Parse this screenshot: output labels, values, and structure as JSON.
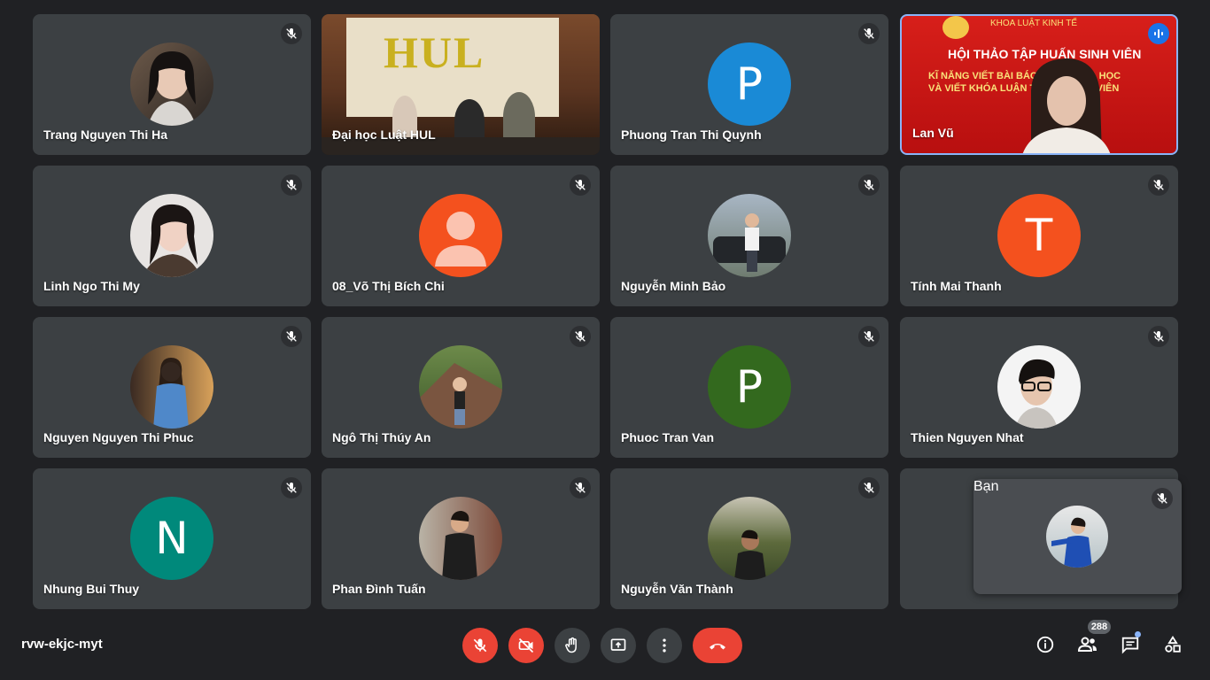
{
  "participants": [
    {
      "name": "Trang Nguyen Thi Ha"
    },
    {
      "name": "Đại học Luật HUL"
    },
    {
      "name": "Phuong Tran Thi Quynh",
      "letter": "P",
      "color": "#1a8ad6"
    },
    {
      "name": "Lan Vũ"
    },
    {
      "name": "Linh Ngo Thi My"
    },
    {
      "name": "08_Võ Thị Bích Chi",
      "color": "#f4511e"
    },
    {
      "name": "Nguyễn Minh Bảo"
    },
    {
      "name": "Tính Mai Thanh",
      "letter": "T",
      "color": "#f4511e"
    },
    {
      "name": "Nguyen Nguyen Thi Phuc"
    },
    {
      "name": "Ngô Thị Thúy An"
    },
    {
      "name": "Phuoc Tran Van",
      "letter": "P",
      "color": "#33691e"
    },
    {
      "name": "Thien Nguyen Nhat"
    },
    {
      "name": "Nhung Bui Thuy",
      "letter": "N",
      "color": "#00897b"
    },
    {
      "name": "Phan Đình Tuấn"
    },
    {
      "name": "Nguyễn Văn Thành"
    }
  ],
  "hul_video": {
    "logo_text": "HUL"
  },
  "lan_video": {
    "banner_sub": "KHOA LUẬT KINH TẾ",
    "banner_title": "HỘI THẢO TẬP HUẤN SINH VIÊN",
    "banner_line1": "KĨ NĂNG VIẾT BÀI BÁO N     ỨU KHOA HỌC",
    "banner_line2": "VÀ VIẾT KHÓA LUẬN TỐ           CHO SINH VIÊN"
  },
  "self_view": {
    "name": "Bạn"
  },
  "meeting": {
    "code": "rvw-ekjc-myt"
  },
  "controls": [
    "mic-off",
    "camera-off",
    "raise-hand",
    "present-screen",
    "more-options",
    "leave-call"
  ],
  "right_panel": {
    "participant_count": "288"
  },
  "colors": {
    "background": "#202124",
    "tile": "#3c4043",
    "danger": "#ea4335",
    "active_speaker": "#8ab4f8"
  }
}
